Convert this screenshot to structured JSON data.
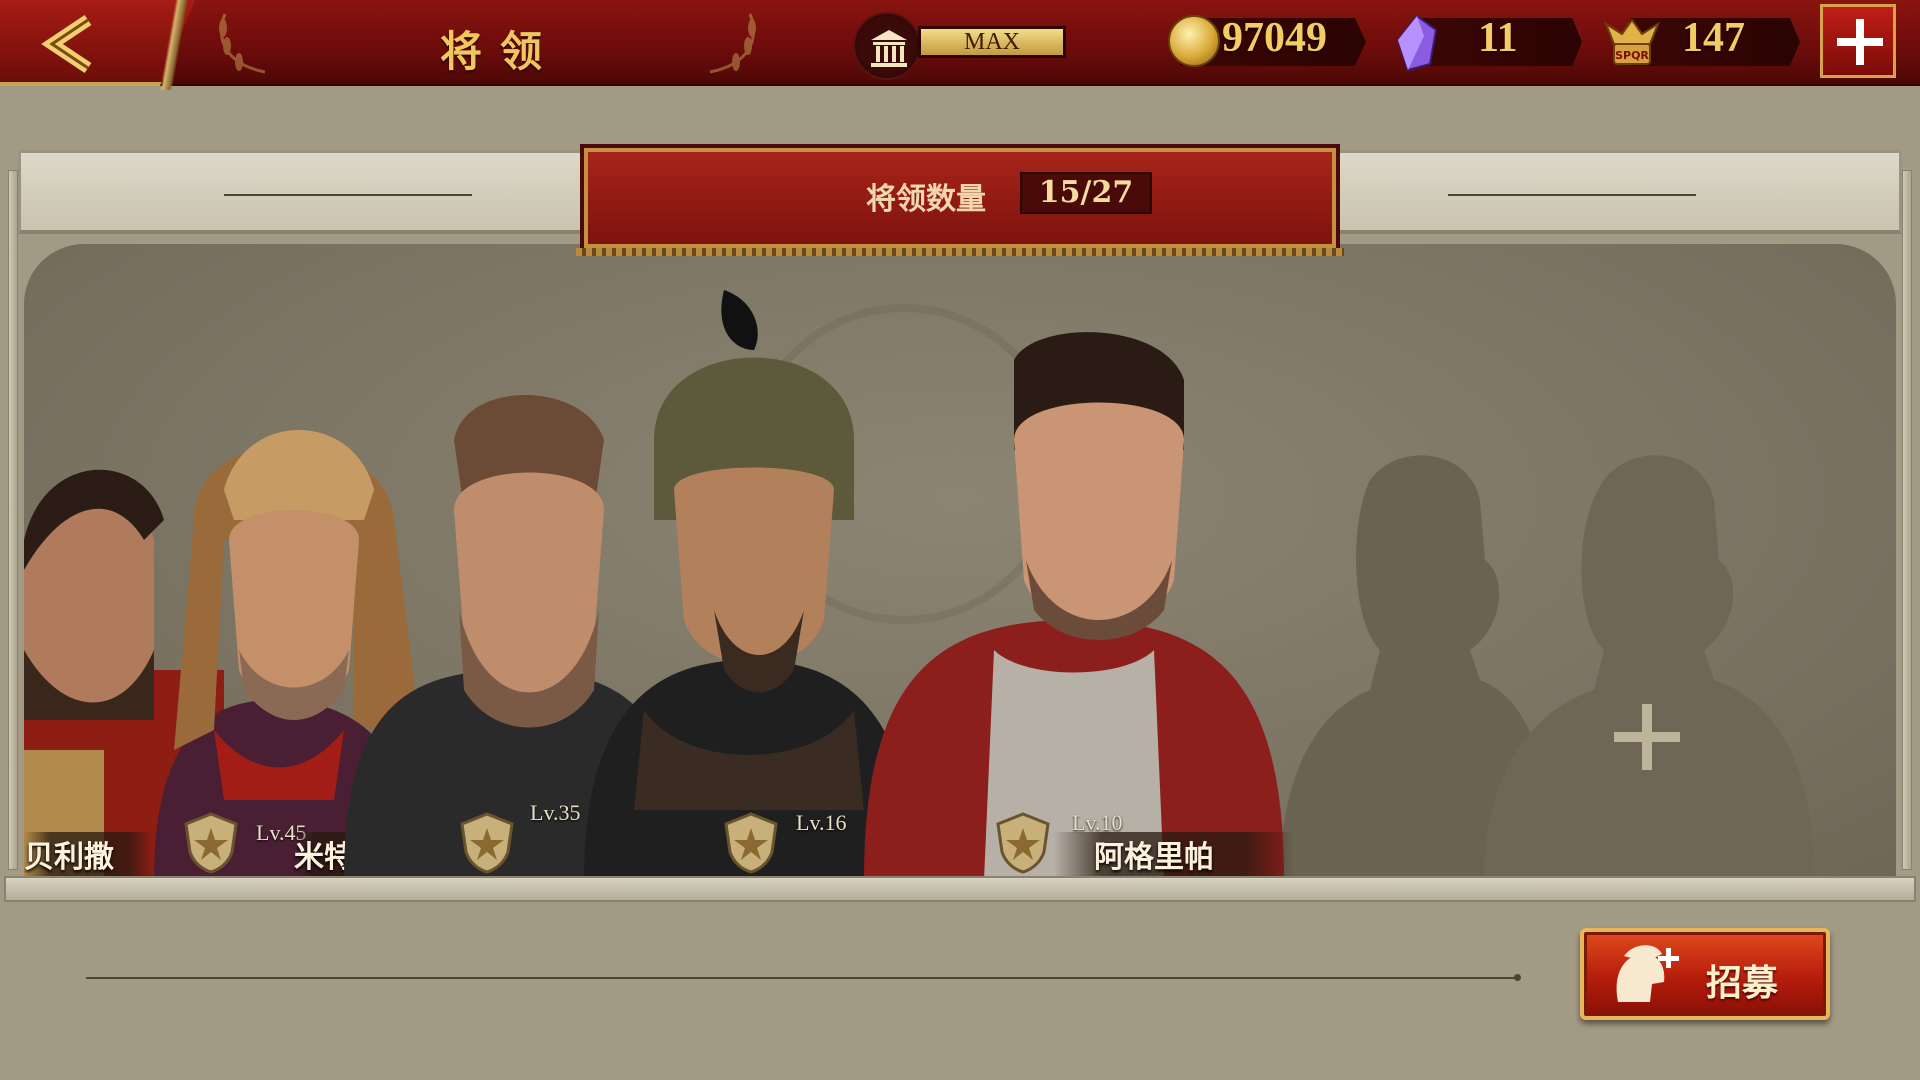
{
  "header": {
    "title": "将领",
    "building_level": "MAX",
    "resources": [
      {
        "name": "gold",
        "value": "97049",
        "icon": "gold-coin-icon"
      },
      {
        "name": "gems",
        "value": "11",
        "icon": "purple-gem-icon"
      },
      {
        "name": "spqr_tokens",
        "value": "147",
        "icon": "spqr-eagle-icon"
      }
    ]
  },
  "banner": {
    "label": "将领数量",
    "count": "15/27"
  },
  "heroes": [
    {
      "name": "贝利撒",
      "level": ""
    },
    {
      "name": "米特",
      "level": "Lv.45"
    },
    {
      "name": "",
      "level": "Lv.35"
    },
    {
      "name": "",
      "level": "Lv.16"
    },
    {
      "name": "阿格里帕",
      "level": "Lv.10"
    }
  ],
  "actions": {
    "recruit_label": "招募"
  },
  "colors": {
    "topbar": "#6b0c0a",
    "gold_text": "#f3cc64",
    "panel_bg": "#7c7463",
    "recruit_button": "#b51d0c"
  }
}
